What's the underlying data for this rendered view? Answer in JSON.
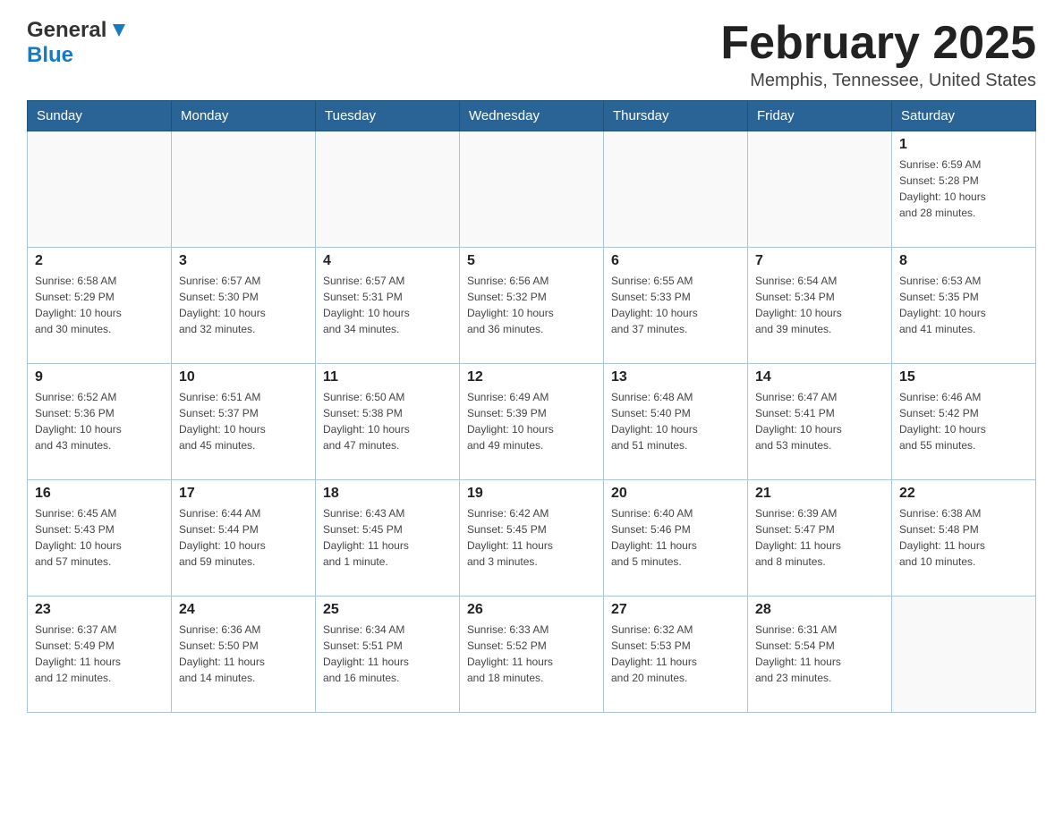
{
  "header": {
    "logo_general": "General",
    "logo_blue": "Blue",
    "month_title": "February 2025",
    "location": "Memphis, Tennessee, United States"
  },
  "days_of_week": [
    "Sunday",
    "Monday",
    "Tuesday",
    "Wednesday",
    "Thursday",
    "Friday",
    "Saturday"
  ],
  "weeks": [
    [
      {
        "day": "",
        "info": ""
      },
      {
        "day": "",
        "info": ""
      },
      {
        "day": "",
        "info": ""
      },
      {
        "day": "",
        "info": ""
      },
      {
        "day": "",
        "info": ""
      },
      {
        "day": "",
        "info": ""
      },
      {
        "day": "1",
        "info": "Sunrise: 6:59 AM\nSunset: 5:28 PM\nDaylight: 10 hours\nand 28 minutes."
      }
    ],
    [
      {
        "day": "2",
        "info": "Sunrise: 6:58 AM\nSunset: 5:29 PM\nDaylight: 10 hours\nand 30 minutes."
      },
      {
        "day": "3",
        "info": "Sunrise: 6:57 AM\nSunset: 5:30 PM\nDaylight: 10 hours\nand 32 minutes."
      },
      {
        "day": "4",
        "info": "Sunrise: 6:57 AM\nSunset: 5:31 PM\nDaylight: 10 hours\nand 34 minutes."
      },
      {
        "day": "5",
        "info": "Sunrise: 6:56 AM\nSunset: 5:32 PM\nDaylight: 10 hours\nand 36 minutes."
      },
      {
        "day": "6",
        "info": "Sunrise: 6:55 AM\nSunset: 5:33 PM\nDaylight: 10 hours\nand 37 minutes."
      },
      {
        "day": "7",
        "info": "Sunrise: 6:54 AM\nSunset: 5:34 PM\nDaylight: 10 hours\nand 39 minutes."
      },
      {
        "day": "8",
        "info": "Sunrise: 6:53 AM\nSunset: 5:35 PM\nDaylight: 10 hours\nand 41 minutes."
      }
    ],
    [
      {
        "day": "9",
        "info": "Sunrise: 6:52 AM\nSunset: 5:36 PM\nDaylight: 10 hours\nand 43 minutes."
      },
      {
        "day": "10",
        "info": "Sunrise: 6:51 AM\nSunset: 5:37 PM\nDaylight: 10 hours\nand 45 minutes."
      },
      {
        "day": "11",
        "info": "Sunrise: 6:50 AM\nSunset: 5:38 PM\nDaylight: 10 hours\nand 47 minutes."
      },
      {
        "day": "12",
        "info": "Sunrise: 6:49 AM\nSunset: 5:39 PM\nDaylight: 10 hours\nand 49 minutes."
      },
      {
        "day": "13",
        "info": "Sunrise: 6:48 AM\nSunset: 5:40 PM\nDaylight: 10 hours\nand 51 minutes."
      },
      {
        "day": "14",
        "info": "Sunrise: 6:47 AM\nSunset: 5:41 PM\nDaylight: 10 hours\nand 53 minutes."
      },
      {
        "day": "15",
        "info": "Sunrise: 6:46 AM\nSunset: 5:42 PM\nDaylight: 10 hours\nand 55 minutes."
      }
    ],
    [
      {
        "day": "16",
        "info": "Sunrise: 6:45 AM\nSunset: 5:43 PM\nDaylight: 10 hours\nand 57 minutes."
      },
      {
        "day": "17",
        "info": "Sunrise: 6:44 AM\nSunset: 5:44 PM\nDaylight: 10 hours\nand 59 minutes."
      },
      {
        "day": "18",
        "info": "Sunrise: 6:43 AM\nSunset: 5:45 PM\nDaylight: 11 hours\nand 1 minute."
      },
      {
        "day": "19",
        "info": "Sunrise: 6:42 AM\nSunset: 5:45 PM\nDaylight: 11 hours\nand 3 minutes."
      },
      {
        "day": "20",
        "info": "Sunrise: 6:40 AM\nSunset: 5:46 PM\nDaylight: 11 hours\nand 5 minutes."
      },
      {
        "day": "21",
        "info": "Sunrise: 6:39 AM\nSunset: 5:47 PM\nDaylight: 11 hours\nand 8 minutes."
      },
      {
        "day": "22",
        "info": "Sunrise: 6:38 AM\nSunset: 5:48 PM\nDaylight: 11 hours\nand 10 minutes."
      }
    ],
    [
      {
        "day": "23",
        "info": "Sunrise: 6:37 AM\nSunset: 5:49 PM\nDaylight: 11 hours\nand 12 minutes."
      },
      {
        "day": "24",
        "info": "Sunrise: 6:36 AM\nSunset: 5:50 PM\nDaylight: 11 hours\nand 14 minutes."
      },
      {
        "day": "25",
        "info": "Sunrise: 6:34 AM\nSunset: 5:51 PM\nDaylight: 11 hours\nand 16 minutes."
      },
      {
        "day": "26",
        "info": "Sunrise: 6:33 AM\nSunset: 5:52 PM\nDaylight: 11 hours\nand 18 minutes."
      },
      {
        "day": "27",
        "info": "Sunrise: 6:32 AM\nSunset: 5:53 PM\nDaylight: 11 hours\nand 20 minutes."
      },
      {
        "day": "28",
        "info": "Sunrise: 6:31 AM\nSunset: 5:54 PM\nDaylight: 11 hours\nand 23 minutes."
      },
      {
        "day": "",
        "info": ""
      }
    ]
  ]
}
